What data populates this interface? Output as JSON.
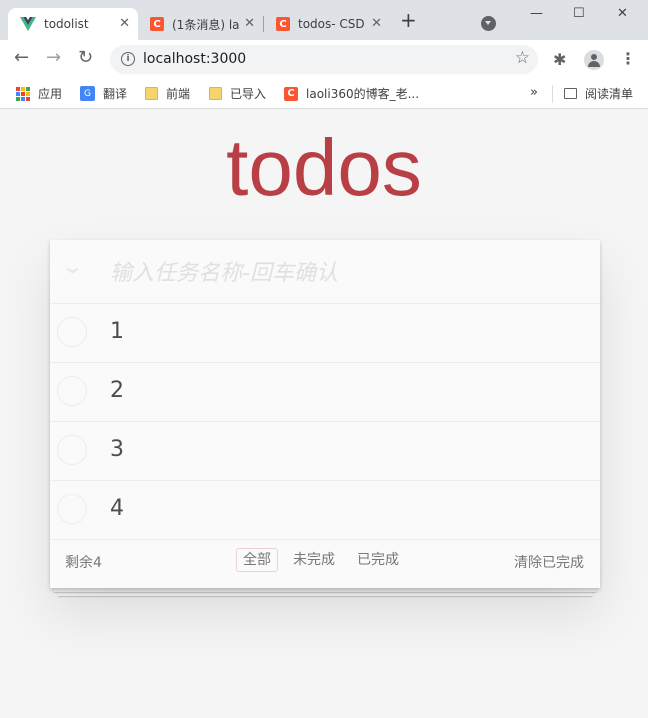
{
  "browser": {
    "tabs": [
      {
        "title": "todolist",
        "active": true,
        "favicon": "vue-icon"
      },
      {
        "title": "(1条消息) la",
        "active": false,
        "favicon": "csdn-icon"
      },
      {
        "title": "todos- CSD",
        "active": false,
        "favicon": "csdn-icon"
      }
    ],
    "close_glyph": "✕",
    "newtab_glyph": "+",
    "window_controls": {
      "minimize": "—",
      "maximize": "☐",
      "close": "✕"
    },
    "address": "localhost:3000",
    "bookmarks": [
      {
        "label": "应用",
        "icon": "apps-icon"
      },
      {
        "label": "翻译",
        "icon": "translate-icon"
      },
      {
        "label": "前端",
        "icon": "folder-icon"
      },
      {
        "label": "已导入",
        "icon": "folder-icon"
      },
      {
        "label": "laoli360的博客_老...",
        "icon": "csdn-icon"
      }
    ],
    "reading_list": "阅读清单",
    "overflow": "»"
  },
  "app": {
    "title": "todos",
    "new_todo_placeholder": "输入任务名称-回车确认",
    "todos": [
      {
        "label": "1",
        "completed": false
      },
      {
        "label": "2",
        "completed": false
      },
      {
        "label": "3",
        "completed": false
      },
      {
        "label": "4",
        "completed": false
      }
    ],
    "footer": {
      "count": "剩余4",
      "filters": [
        {
          "label": "全部",
          "selected": true
        },
        {
          "label": "未完成",
          "selected": false
        },
        {
          "label": "已完成",
          "selected": false
        }
      ],
      "clear_completed": "清除已完成"
    }
  },
  "colors": {
    "title": "#b83f45",
    "vue_green": "#41b883",
    "csdn_red": "#fc5531"
  }
}
